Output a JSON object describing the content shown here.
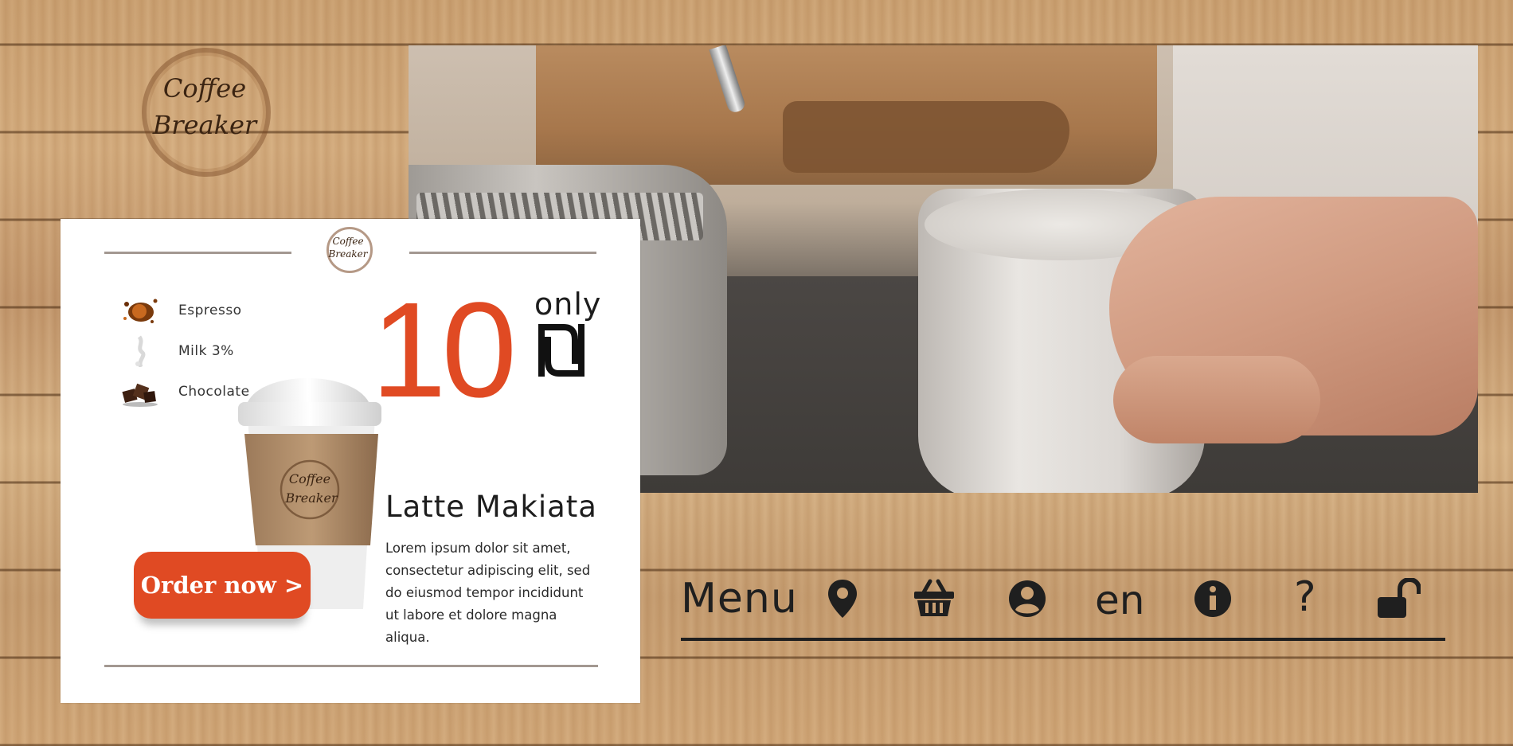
{
  "brand": {
    "logo_line1": "Coffee",
    "logo_line2": "Breaker"
  },
  "card": {
    "logo_line1": "Coffee",
    "logo_line2": "Breaker",
    "cup_logo_line1": "Coffee",
    "cup_logo_line2": "Breaker",
    "ingredients": [
      {
        "label": "Espresso",
        "icon": "espresso-splash-icon"
      },
      {
        "label": "Milk 3%",
        "icon": "milk-splash-icon"
      },
      {
        "label": "Chocolate",
        "icon": "chocolate-pieces-icon"
      }
    ],
    "price": "10",
    "price_prefix": "only",
    "currency_icon": "shekel-icon",
    "product_name": "Latte Makiata",
    "description": "Lorem ipsum dolor sit amet, consectetur adipiscing elit, sed do eiusmod tempor incididunt ut labore et dolore magna aliqua.",
    "order_button": "Order now >"
  },
  "nav": {
    "menu_label": "Menu",
    "language": "en",
    "help": "?",
    "icons": [
      "location-pin-icon",
      "basket-icon",
      "user-circle-icon",
      "info-icon",
      "unlock-icon"
    ]
  },
  "colors": {
    "accent": "#e04a23",
    "text": "#1f1f1f",
    "rule": "#a39891"
  }
}
